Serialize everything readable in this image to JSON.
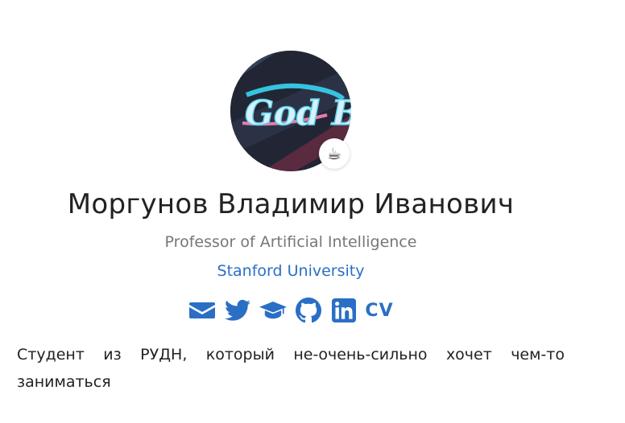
{
  "profile": {
    "name": "Моргунов Владимир Иванович",
    "title": "Professor of Artificial Intelligence",
    "affiliation": "Stanford University",
    "avatar_alt": "God By",
    "status_emoji": "☕",
    "bio": "Студент из РУДН, который не-очень-сильно хочет чем-то заниматься"
  },
  "social": {
    "cv_label": "CV",
    "icons": [
      "envelope-icon",
      "twitter-icon",
      "graduation-cap-icon",
      "github-icon",
      "linkedin-icon",
      "cv-icon"
    ]
  },
  "colors": {
    "accent": "#2a6fc5",
    "text": "#222222",
    "muted": "#777777"
  }
}
